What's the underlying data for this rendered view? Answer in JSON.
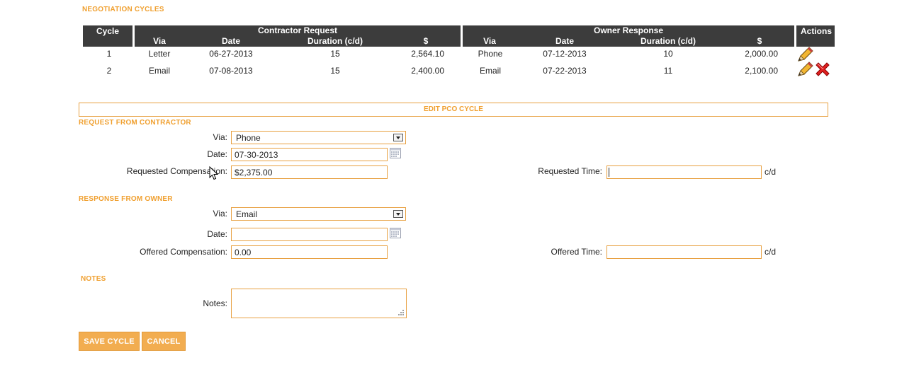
{
  "sections": {
    "negotiation_cycles": "NEGOTIATION CYCLES",
    "edit_pco_cycle": "EDIT PCO CYCLE",
    "request_from_contractor": "REQUEST FROM CONTRACTOR",
    "response_from_owner": "RESPONSE FROM OWNER",
    "notes": "NOTES"
  },
  "table": {
    "cycle": "Cycle",
    "contractor_request": "Contractor Request",
    "owner_response": "Owner Response",
    "actions": "Actions",
    "sub_via": "Via",
    "sub_date": "Date",
    "sub_duration": "Duration (c/d)",
    "sub_amount": "$",
    "rows": [
      {
        "cycle": "1",
        "req_via": "Letter",
        "req_date": "06-27-2013",
        "req_duration": "15",
        "req_amount": "2,564.10",
        "own_via": "Phone",
        "own_date": "07-12-2013",
        "own_duration": "10",
        "own_amount": "2,000.00"
      },
      {
        "cycle": "2",
        "req_via": "Email",
        "req_date": "07-08-2013",
        "req_duration": "15",
        "req_amount": "2,400.00",
        "own_via": "Email",
        "own_date": "07-22-2013",
        "own_duration": "11",
        "own_amount": "2,100.00"
      }
    ]
  },
  "request": {
    "via_label": "Via:",
    "via_value": "Phone",
    "date_label": "Date:",
    "date_value": "07-30-2013",
    "comp_label": "Requested Compensation:",
    "comp_value": "$2,375.00",
    "time_label": "Requested Time:",
    "time_value": "",
    "time_unit": "c/d"
  },
  "response": {
    "via_label": "Via:",
    "via_value": "Email",
    "date_label": "Date:",
    "date_value": "",
    "comp_label": "Offered Compensation:",
    "comp_value": "0.00",
    "time_label": "Offered Time:",
    "time_value": "",
    "time_unit": "c/d"
  },
  "notes": {
    "label": "Notes:",
    "value": ""
  },
  "buttons": {
    "save": "SAVE CYCLE",
    "cancel": "CANCEL"
  },
  "colors": {
    "accent": "#f0a030",
    "header_bg": "#3c3c3c",
    "input_border": "#e8a040"
  }
}
